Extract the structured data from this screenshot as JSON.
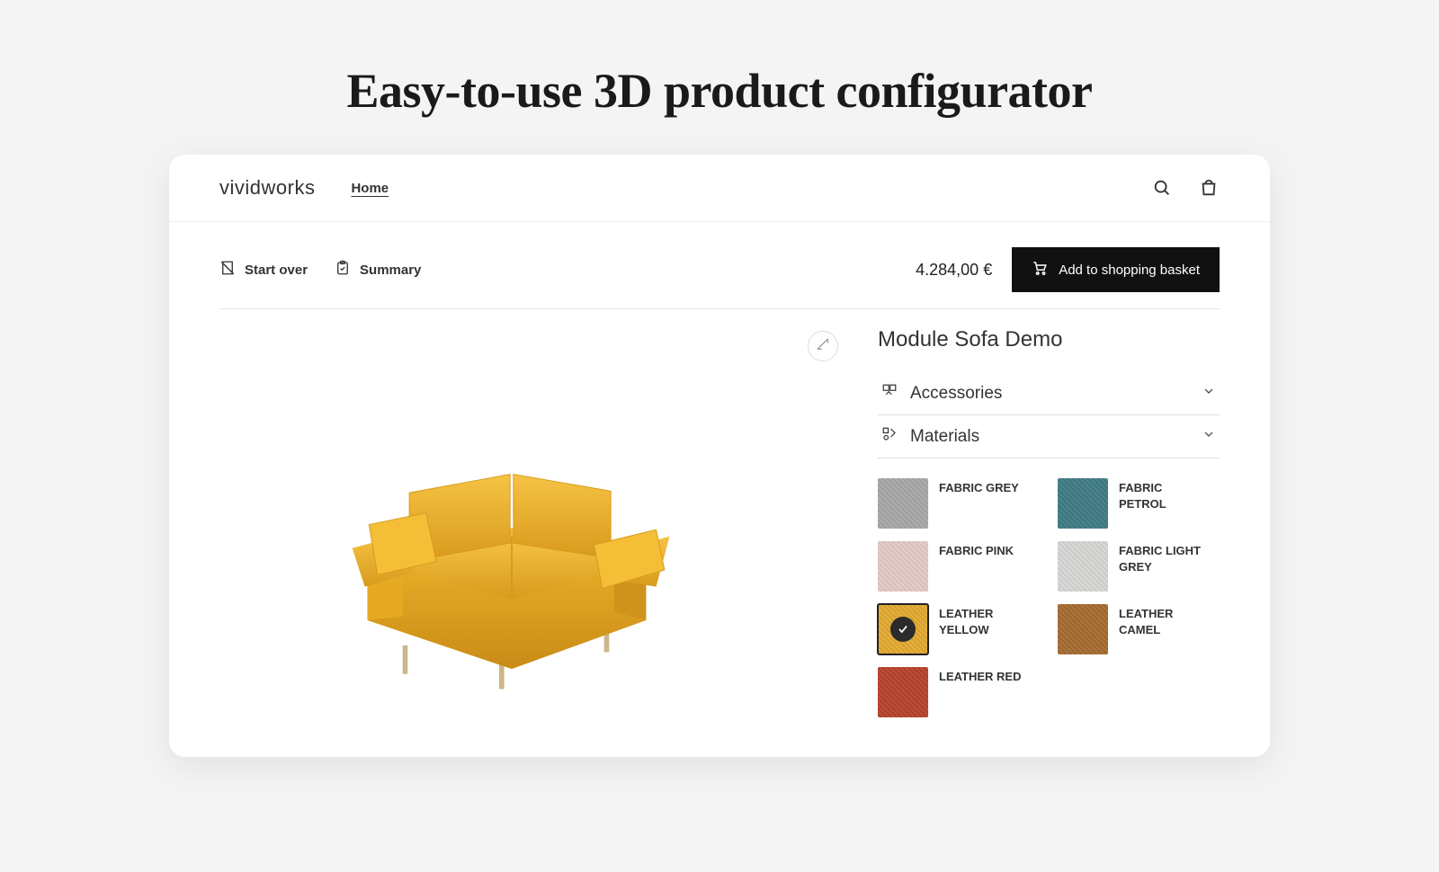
{
  "hero": {
    "title": "Easy-to-use 3D product configurator"
  },
  "header": {
    "brand": "vividworks",
    "nav_home": "Home"
  },
  "toolbar": {
    "start_over": "Start over",
    "summary": "Summary",
    "price": "4.284,00 €",
    "add_label": "Add to shopping basket"
  },
  "product": {
    "title": "Module Sofa Demo"
  },
  "accordion": {
    "accessories": "Accessories",
    "materials": "Materials"
  },
  "swatches": [
    {
      "name": "FABRIC GREY",
      "color": "#a7a7a7",
      "selected": false
    },
    {
      "name": "FABRIC PETROL",
      "color": "#3f7b85",
      "selected": false
    },
    {
      "name": "FABRIC PINK",
      "color": "#e3c9c4",
      "selected": false
    },
    {
      "name": "FABRIC LIGHT GREY",
      "color": "#d6d6d4",
      "selected": false
    },
    {
      "name": "LEATHER YELLOW",
      "color": "#e2a92f",
      "selected": true
    },
    {
      "name": "LEATHER CAMEL",
      "color": "#a56b2f",
      "selected": false
    },
    {
      "name": "LEATHER RED",
      "color": "#b6412b",
      "selected": false
    }
  ],
  "colors": {
    "sofa": "#f2b82e"
  }
}
